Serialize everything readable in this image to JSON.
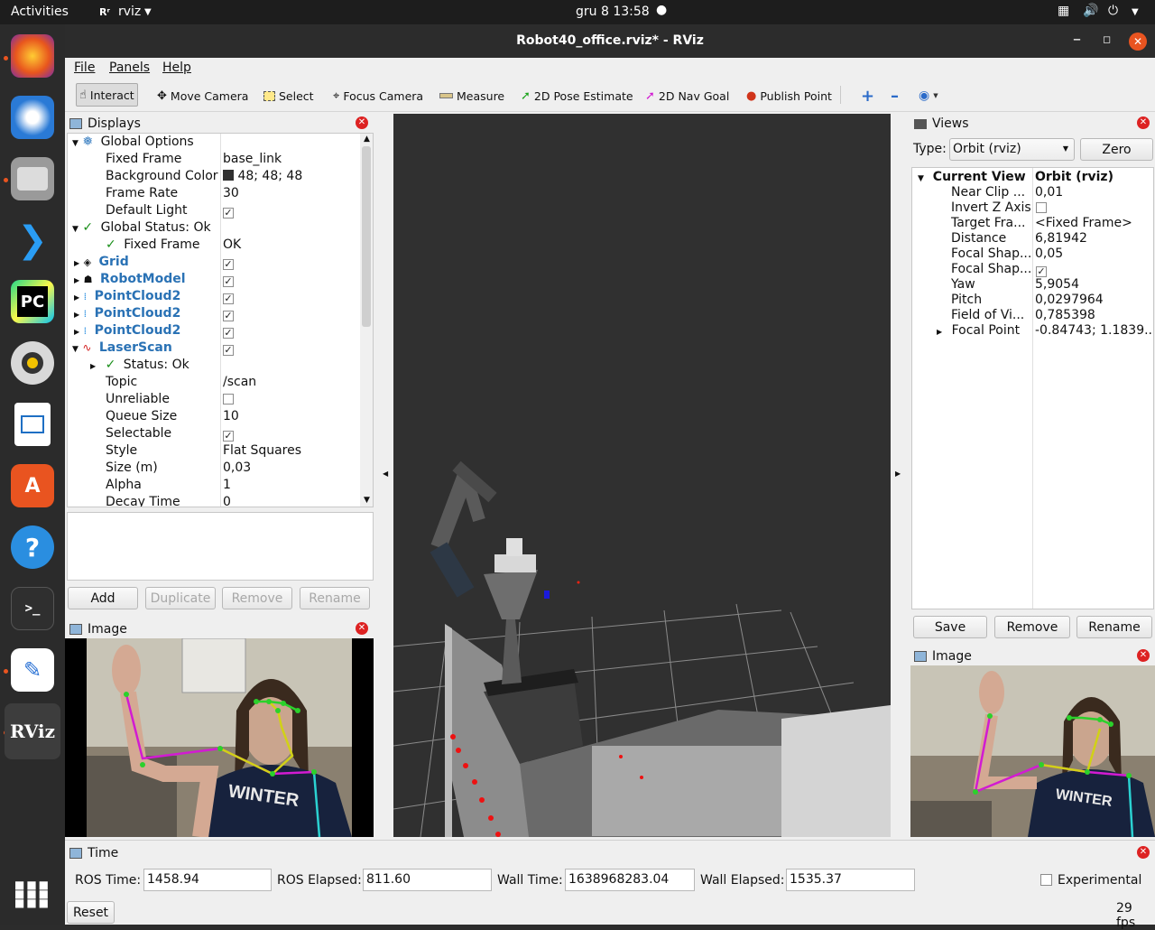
{
  "topbar": {
    "activities": "Activities",
    "app": "rviz",
    "clock": "gru 8  13:58"
  },
  "dock": {
    "icons": [
      "firefox-icon",
      "thunderbird-icon",
      "files-icon",
      "vscode-icon",
      "pycharm-icon",
      "rhythmbox-icon",
      "writer-icon",
      "app-center-icon",
      "help-icon",
      "terminal-icon",
      "text-editor-icon",
      "rviz-icon",
      "app-grid-icon"
    ],
    "pycharm_text": "PC",
    "rviz_text": "RViz"
  },
  "window": {
    "title": "Robot40_office.rviz* - RViz"
  },
  "menu": {
    "file": "File",
    "panels": "Panels",
    "help": "Help"
  },
  "toolbar": {
    "interact": "Interact",
    "move_camera": "Move Camera",
    "select": "Select",
    "focus_camera": "Focus Camera",
    "measure": "Measure",
    "pose_estimate": "2D Pose Estimate",
    "nav_goal": "2D Nav Goal",
    "publish_point": "Publish Point"
  },
  "displays": {
    "title": "Displays",
    "rows": {
      "global_options": "Global Options",
      "fixed_frame": "Fixed Frame",
      "fixed_frame_val": "base_link",
      "bg_color": "Background Color",
      "bg_color_val": "48; 48; 48",
      "frame_rate": "Frame Rate",
      "frame_rate_val": "30",
      "default_light": "Default Light",
      "global_status": "Global Status: Ok",
      "fixed_frame_status": "Fixed Frame",
      "fixed_frame_status_val": "OK",
      "grid": "Grid",
      "robot_model": "RobotModel",
      "pc1": "PointCloud2",
      "pc2": "PointCloud2",
      "pc3": "PointCloud2",
      "laserscan": "LaserScan",
      "status_ok": "Status: Ok",
      "topic": "Topic",
      "topic_val": "/scan",
      "unreliable": "Unreliable",
      "queue_size": "Queue Size",
      "queue_size_val": "10",
      "selectable": "Selectable",
      "style": "Style",
      "style_val": "Flat Squares",
      "size": "Size (m)",
      "size_val": "0,03",
      "alpha": "Alpha",
      "alpha_val": "1",
      "decay": "Decay Time",
      "decay_val": "0"
    },
    "buttons": {
      "add": "Add",
      "duplicate": "Duplicate",
      "remove": "Remove",
      "rename": "Rename"
    }
  },
  "image_left": {
    "title": "Image"
  },
  "views": {
    "title": "Views",
    "type_label": "Type:",
    "type_val": "Orbit (rviz)",
    "zero": "Zero",
    "rows": {
      "current_view": "Current View",
      "current_view_val": "Orbit (rviz)",
      "near_clip": "Near Clip ...",
      "near_clip_val": "0,01",
      "invert_z": "Invert Z Axis",
      "target_frame": "Target Fra...",
      "target_frame_val": "<Fixed Frame>",
      "distance": "Distance",
      "distance_val": "6,81942",
      "focal_shape1": "Focal Shap...",
      "focal_shape1_val": "0,05",
      "focal_shape2": "Focal Shap...",
      "yaw": "Yaw",
      "yaw_val": "5,9054",
      "pitch": "Pitch",
      "pitch_val": "0,0297964",
      "fov": "Field of Vi...",
      "fov_val": "0,785398",
      "focal_point": "Focal Point",
      "focal_point_val": "-0.84743; 1.1839..."
    },
    "buttons": {
      "save": "Save",
      "remove": "Remove",
      "rename": "Rename"
    }
  },
  "image_right": {
    "title": "Image"
  },
  "time": {
    "title": "Time",
    "ros_time_label": "ROS Time:",
    "ros_time": "1458.94",
    "ros_elapsed_label": "ROS Elapsed:",
    "ros_elapsed": "811.60",
    "wall_time_label": "Wall Time:",
    "wall_time": "1638968283.04",
    "wall_elapsed_label": "Wall Elapsed:",
    "wall_elapsed": "1535.37",
    "experimental": "Experimental",
    "reset": "Reset",
    "fps": "29 fps"
  },
  "sweater_text": "WINTER",
  "colors": {
    "bg_swatch": "#303030",
    "accent": "#e95420",
    "link_blue": "#2a72b5"
  }
}
